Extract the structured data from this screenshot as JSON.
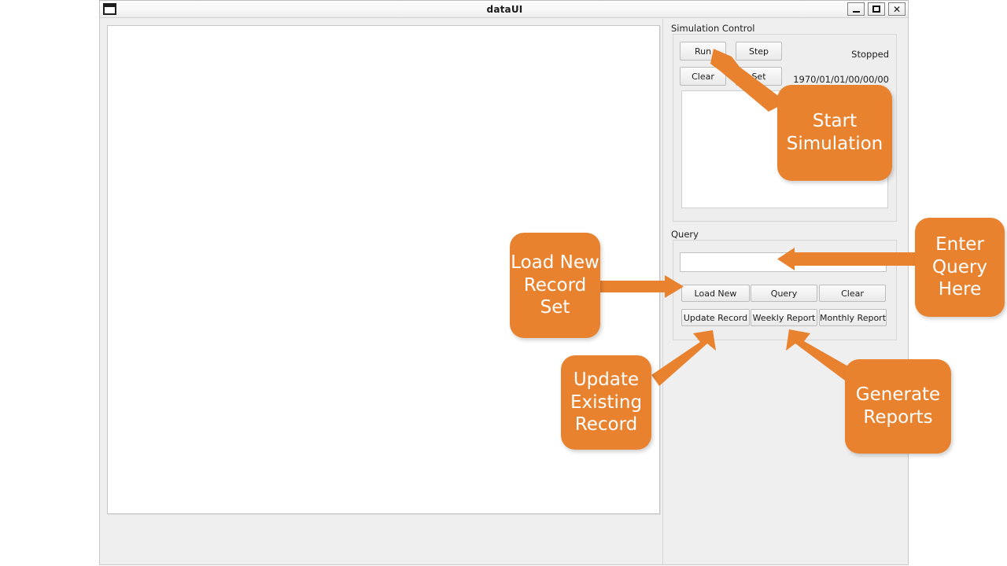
{
  "window": {
    "title": "dataUI",
    "app_icon": "window-icon",
    "controls": {
      "minimize": "minimize-icon",
      "maximize": "maximize-icon",
      "close": "close-icon"
    }
  },
  "simulation_control": {
    "group_label": "Simulation Control",
    "buttons": [
      {
        "label": "Run",
        "name": "run-button"
      },
      {
        "label": "Step",
        "name": "step-button"
      },
      {
        "label": "Clear",
        "name": "clear-button"
      },
      {
        "label": "Set",
        "name": "set-button"
      }
    ],
    "status": "Stopped",
    "timestamp": "1970/01/01/00/00/00",
    "log_text": ""
  },
  "query": {
    "group_label": "Query",
    "input_value": "",
    "input_placeholder": "",
    "buttons": [
      {
        "label": "Load New",
        "name": "load-new-button"
      },
      {
        "label": "Query",
        "name": "query-button"
      },
      {
        "label": "Clear",
        "name": "query-clear-button"
      },
      {
        "label": "Update Record",
        "name": "update-record-button"
      },
      {
        "label": "Weekly Report",
        "name": "weekly-report-button"
      },
      {
        "label": "Monthly Report",
        "name": "monthly-report-button"
      }
    ]
  },
  "annotations": {
    "accent_color": "#E8822F",
    "callouts": [
      {
        "id": "start-simulation",
        "text": "Start Simulation"
      },
      {
        "id": "enter-query-here",
        "text": "Enter Query Here"
      },
      {
        "id": "load-new-record",
        "text": "Load New Record Set"
      },
      {
        "id": "update-existing",
        "text": "Update Existing Record"
      },
      {
        "id": "generate-reports",
        "text": "Generate Reports"
      }
    ]
  },
  "canvas": {
    "content": ""
  }
}
